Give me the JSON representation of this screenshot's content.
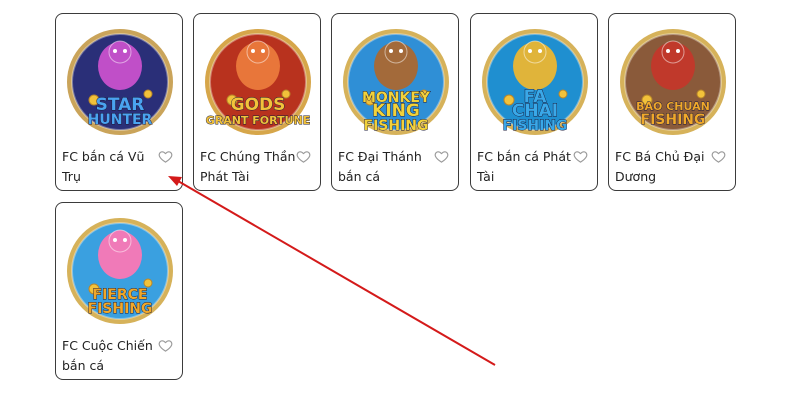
{
  "games": [
    {
      "title": "FC bắn cá Vũ Trụ",
      "logo_lines": [
        "STAR",
        "HUNTER"
      ],
      "logo_color": "#4aa3f0",
      "ring_color": "#caa45a",
      "bg_color": "#2a2f78",
      "hero_color": "#c04fc8",
      "fav_icon": "heart-outline-icon"
    },
    {
      "title": "FC Chúng Thần Phát Tài",
      "logo_lines": [
        "GODS",
        "GRANT FORTUNE"
      ],
      "logo_color": "#f2c23a",
      "ring_color": "#d6a64a",
      "bg_color": "#b8321e",
      "hero_color": "#e8763a",
      "fav_icon": "heart-outline-icon"
    },
    {
      "title": "FC Đại Thánh bắn cá",
      "logo_lines": [
        "MONKEY",
        "KING",
        "FISHING"
      ],
      "logo_color": "#f2d23a",
      "ring_color": "#d6b25a",
      "bg_color": "#2f8fd6",
      "hero_color": "#a36a3a",
      "fav_icon": "heart-outline-icon"
    },
    {
      "title": "FC bắn cá Phát Tài",
      "logo_lines": [
        "FA",
        "CHAI",
        "FISHING"
      ],
      "logo_color": "#3aa8e8",
      "ring_color": "#d6b25a",
      "bg_color": "#1f8fd0",
      "hero_color": "#e0b43a",
      "fav_icon": "heart-outline-icon"
    },
    {
      "title": "FC Bá Chủ Đại Dương",
      "logo_lines": [
        "BAO CHUAN",
        "FISHING"
      ],
      "logo_color": "#f0a82a",
      "ring_color": "#d6b25a",
      "bg_color": "#8a5a3a",
      "hero_color": "#c0392b",
      "fav_icon": "heart-outline-icon"
    },
    {
      "title": "FC Cuộc Chiến bắn cá",
      "logo_lines": [
        "FIERCE",
        "FISHING"
      ],
      "logo_color": "#f0a82a",
      "ring_color": "#d6b25a",
      "bg_color": "#3aa0e0",
      "hero_color": "#f07ab8",
      "fav_icon": "heart-outline-icon"
    }
  ],
  "annotation": {
    "icon": "red-arrow-annotation",
    "color": "#d41a1a"
  }
}
